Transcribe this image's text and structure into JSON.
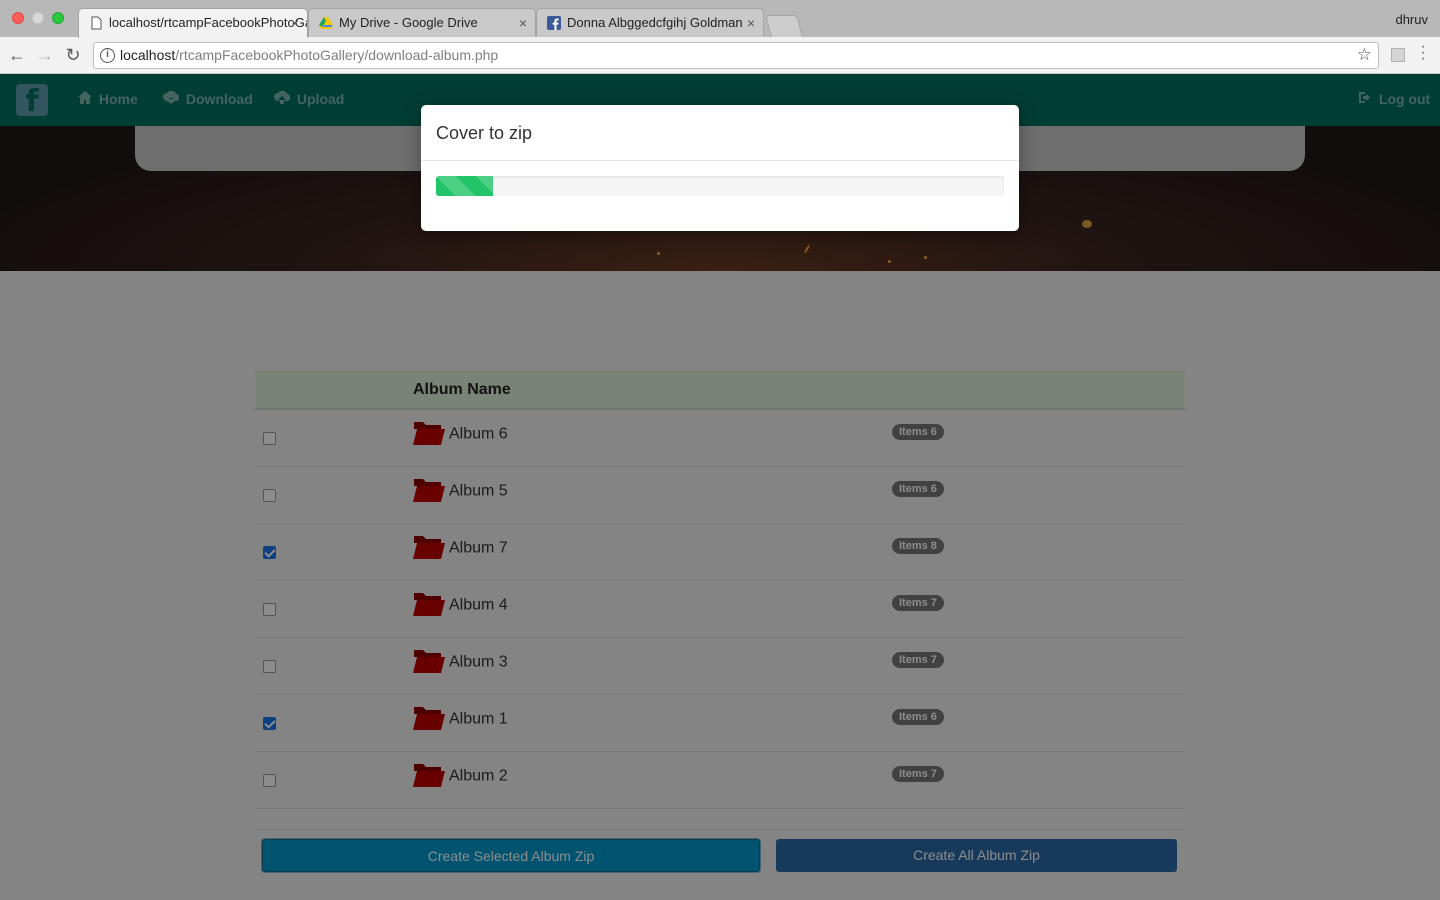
{
  "browser": {
    "tabs": [
      {
        "title": "localhost/rtcampFacebookPhotoGallery/download-album.php",
        "favicon": "page-icon",
        "active": true
      },
      {
        "title": "My Drive - Google Drive",
        "favicon": "google-drive-icon",
        "active": false
      },
      {
        "title": "Donna Albggedcfgihj Goldman",
        "favicon": "facebook-icon",
        "active": false
      }
    ],
    "profile": "dhruv",
    "url_host": "localhost",
    "url_path": "/rtcampFacebookPhotoGallery/download-album.php",
    "tab_close": "×"
  },
  "navbar": {
    "brand": "f",
    "links": [
      {
        "label": "Home",
        "icon": "home-icon"
      },
      {
        "label": "Download",
        "icon": "cloud-download-icon"
      },
      {
        "label": "Upload",
        "icon": "cloud-upload-icon"
      }
    ],
    "logout": "Log out"
  },
  "table": {
    "headers": [
      "",
      "Album Name",
      ""
    ],
    "rows": [
      {
        "name": "Album 6",
        "items": "Items 6",
        "checked": false
      },
      {
        "name": "Album 5",
        "items": "Items 6",
        "checked": false
      },
      {
        "name": "Album 7",
        "items": "Items 8",
        "checked": true
      },
      {
        "name": "Album 4",
        "items": "Items 7",
        "checked": false
      },
      {
        "name": "Album 3",
        "items": "Items 7",
        "checked": false
      },
      {
        "name": "Album 1",
        "items": "Items 6",
        "checked": true
      },
      {
        "name": "Album 2",
        "items": "Items 7",
        "checked": false
      }
    ]
  },
  "buttons": {
    "selected_zip": "Create Selected Album Zip",
    "all_zip": "Create All Album Zip"
  },
  "modal": {
    "title": "Cover to zip",
    "progress_fraction": 0.1
  },
  "colors": {
    "navbar": "#016f5d",
    "progress": "#22c46a",
    "folder": "#c00000",
    "header_row": "#dff0d8"
  }
}
